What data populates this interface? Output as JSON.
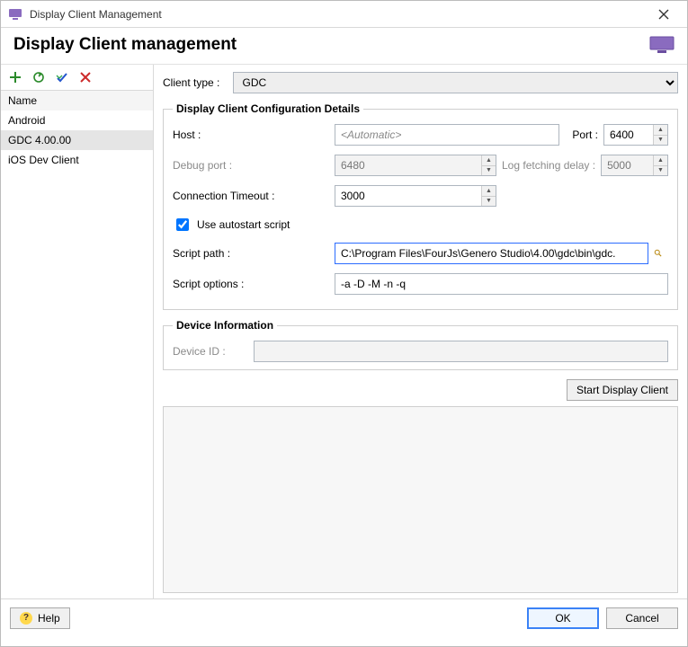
{
  "window": {
    "title": "Display Client Management"
  },
  "header": {
    "title": "Display Client management"
  },
  "toolbar": {
    "add": "+",
    "refresh": "⟳",
    "validate": "✔",
    "delete": "✕"
  },
  "list": {
    "header": "Name",
    "items": [
      {
        "label": "Android",
        "selected": false
      },
      {
        "label": "GDC 4.00.00",
        "selected": true
      },
      {
        "label": "iOS Dev Client",
        "selected": false
      }
    ]
  },
  "form": {
    "client_type_label": "Client type :",
    "client_type_value": "GDC",
    "config_legend": "Display Client Configuration Details",
    "host_label": "Host :",
    "host_placeholder": "<Automatic>",
    "host_value": "",
    "port_label": "Port :",
    "port_value": "6400",
    "debug_port_label": "Debug port :",
    "debug_port_value": "6480",
    "log_delay_label": "Log fetching delay :",
    "log_delay_value": "5000",
    "conn_timeout_label": "Connection Timeout :",
    "conn_timeout_value": "3000",
    "autostart_label": "Use autostart script",
    "autostart_checked": true,
    "script_path_label": "Script path :",
    "script_path_value": "C:\\Program Files\\FourJs\\Genero Studio\\4.00\\gdc\\bin\\gdc.",
    "script_options_label": "Script options :",
    "script_options_value": "-a -D -M -n -q",
    "device_legend": "Device Information",
    "device_id_label": "Device ID :",
    "device_id_value": "",
    "start_button": "Start Display Client"
  },
  "footer": {
    "help": "Help",
    "ok": "OK",
    "cancel": "Cancel"
  }
}
